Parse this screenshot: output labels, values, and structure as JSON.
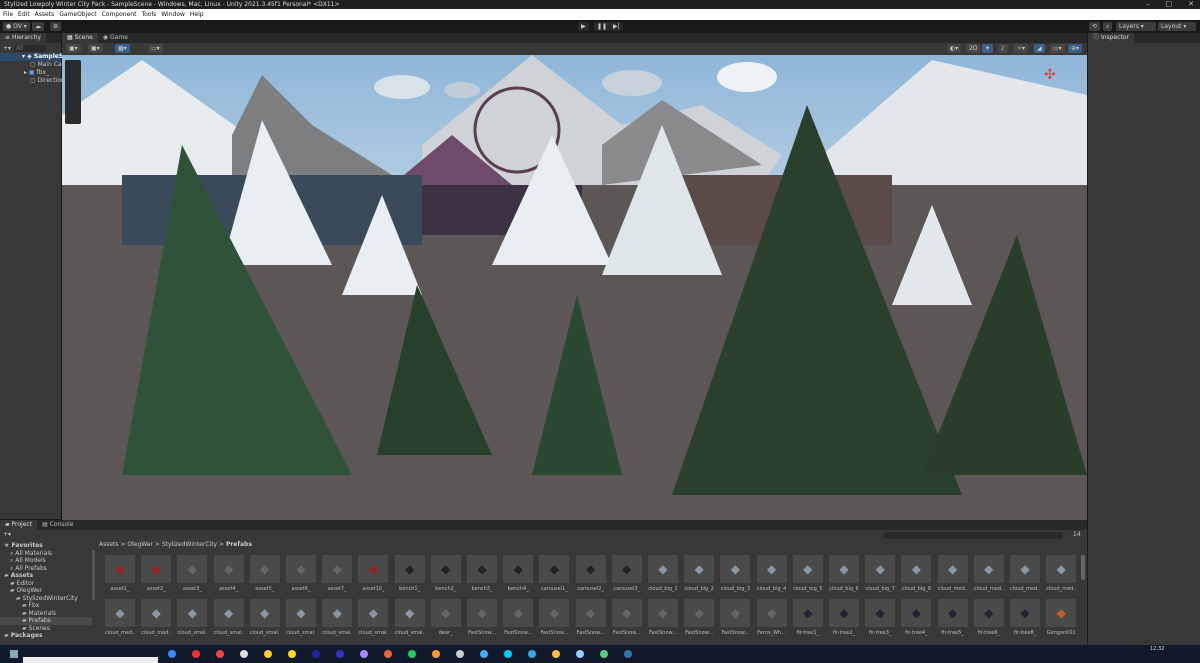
{
  "window": {
    "title": "Stylized Lowpoly Winter City Pack - SampleScene - Windows, Mac, Linux - Unity 2021.3.45f1 Personal* <DX11>",
    "controls": [
      "–",
      "□",
      "✕"
    ]
  },
  "menu": [
    "File",
    "Edit",
    "Assets",
    "GameObject",
    "Component",
    "Tools",
    "Window",
    "Help"
  ],
  "toolbar": {
    "account": "OV ▾",
    "layers": "Layers",
    "layout": "Layout"
  },
  "hierarchy": {
    "tab": "Hierarchy",
    "search_placeholder": "All",
    "items": [
      "SampleScene",
      "Main Camera",
      "fbx_",
      "Directional Light"
    ]
  },
  "scene": {
    "tabs": [
      "Scene",
      "Game"
    ],
    "mode_2d": "2D",
    "tools": [
      "view",
      "move",
      "rotate",
      "scale",
      "rect",
      "transform"
    ]
  },
  "inspector": {
    "tab": "Inspector"
  },
  "project": {
    "tabs": [
      "Project",
      "Console"
    ],
    "tree": [
      {
        "label": "Favorites",
        "d": 0,
        "ic": "★"
      },
      {
        "label": "All Materials",
        "d": 1,
        "ic": "⌕"
      },
      {
        "label": "All Models",
        "d": 1,
        "ic": "⌕"
      },
      {
        "label": "All Prefabs",
        "d": 1,
        "ic": "⌕"
      },
      {
        "label": "Assets",
        "d": 0,
        "ic": "▰"
      },
      {
        "label": "Editor",
        "d": 1,
        "ic": "▰"
      },
      {
        "label": "OlegWer",
        "d": 1,
        "ic": "▰"
      },
      {
        "label": "StylizedWinterCity",
        "d": 2,
        "ic": "▰"
      },
      {
        "label": "Fbx",
        "d": 3,
        "ic": "▰"
      },
      {
        "label": "Materials",
        "d": 3,
        "ic": "▰"
      },
      {
        "label": "Prefabs",
        "d": 3,
        "ic": "▰"
      },
      {
        "label": "Scenes",
        "d": 3,
        "ic": "▰"
      },
      {
        "label": "Packages",
        "d": 0,
        "ic": "▰"
      }
    ],
    "breadcrumb": [
      "Assets",
      "OlegWer",
      "StylizedWinterCity",
      "Prefabs"
    ],
    "count": "14",
    "row1": [
      "asset1_",
      "asset2_",
      "asset3_",
      "asset4_",
      "asset5_",
      "asset6_",
      "asset7_",
      "asset10_",
      "bench1_",
      "bench2_",
      "bench3_",
      "bench4_",
      "carousel1_",
      "carousel2_",
      "carousel3_",
      "cloud_big_1",
      "cloud_big_2",
      "cloud_big_3",
      "cloud_big_4",
      "cloud_big_5",
      "cloud_big_6",
      "cloud_big_7",
      "cloud_big_8",
      "cloud_med...",
      "cloud_med...",
      "cloud_med...",
      "cloud_med..."
    ],
    "row2": [
      "cloud_med...",
      "cloud_med...",
      "cloud_smal...",
      "cloud_smal...",
      "cloud_smal...",
      "cloud_smal...",
      "cloud_smal...",
      "cloud_smal...",
      "cloud_smal...",
      "deer_",
      "FastSnow...",
      "FastSnow...",
      "FastSnow...",
      "FastSnow...",
      "FastSnow...",
      "FastSnow...",
      "FastSnow...",
      "FastSnow...",
      "Ferns_Wh...",
      "fir-tree1_",
      "fir-tree2_",
      "fir-tree3_",
      "fir-tree4_",
      "fir-tree5_",
      "fir-tree6_",
      "fir-tree8_",
      "Gengon001"
    ]
  },
  "taskbar": {
    "clock": "12:32"
  }
}
